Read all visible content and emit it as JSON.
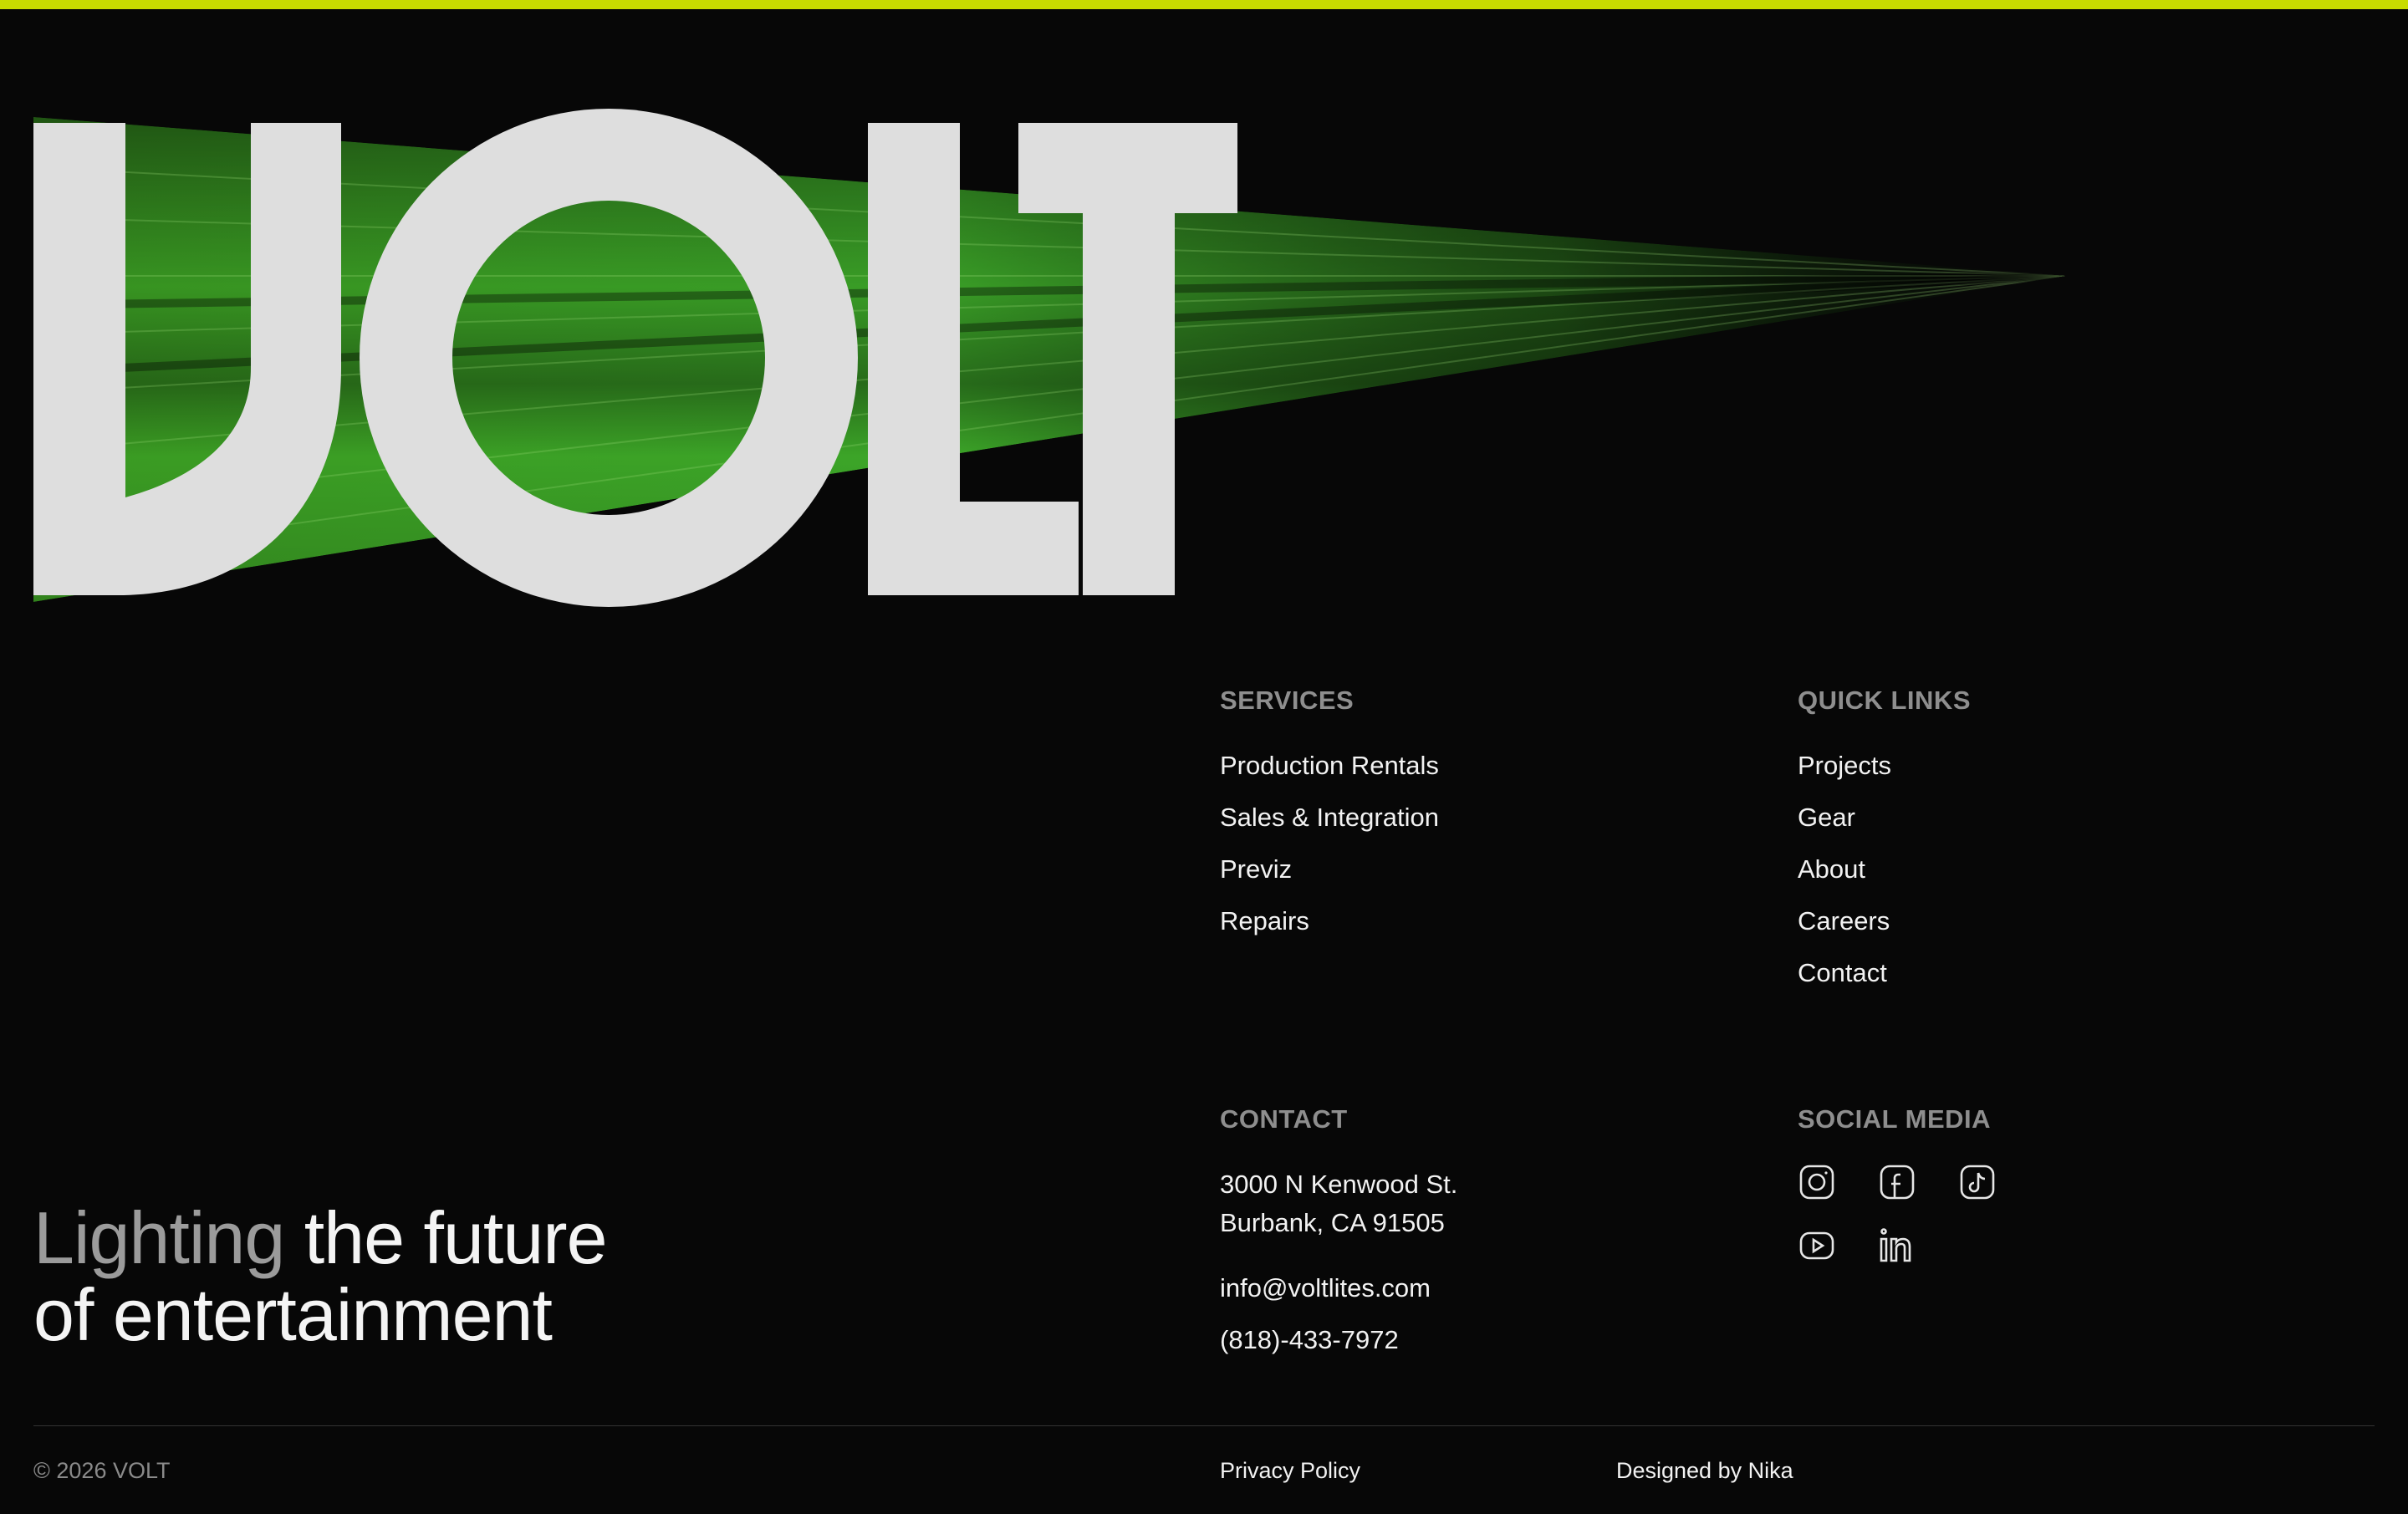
{
  "brand": {
    "logo_text": "VOLT",
    "accent_color": "#c8dc00",
    "beam_color": "#3fae2a"
  },
  "tagline": {
    "dim_part": "Lighting",
    "bright_part_line1": " the future",
    "line2": "of entertainment"
  },
  "services": {
    "heading": "SERVICES",
    "items": [
      "Production Rentals",
      "Sales & Integration",
      "Previz",
      "Repairs"
    ]
  },
  "quick_links": {
    "heading": "QUICK LINKS",
    "items": [
      "Projects",
      "Gear",
      "About",
      "Careers",
      "Contact"
    ]
  },
  "contact": {
    "heading": "CONTACT",
    "address_line1": "3000 N Kenwood St.",
    "address_line2": "Burbank, CA 91505",
    "email": "info@voltlites.com",
    "phone": "(818)-433-7972"
  },
  "social": {
    "heading": "SOCIAL MEDIA",
    "icons": [
      "instagram-icon",
      "facebook-icon",
      "tiktok-icon",
      "youtube-icon",
      "linkedin-icon"
    ]
  },
  "footer": {
    "copyright": "© 2026 VOLT",
    "privacy": "Privacy Policy",
    "credit": "Designed by Nika"
  }
}
